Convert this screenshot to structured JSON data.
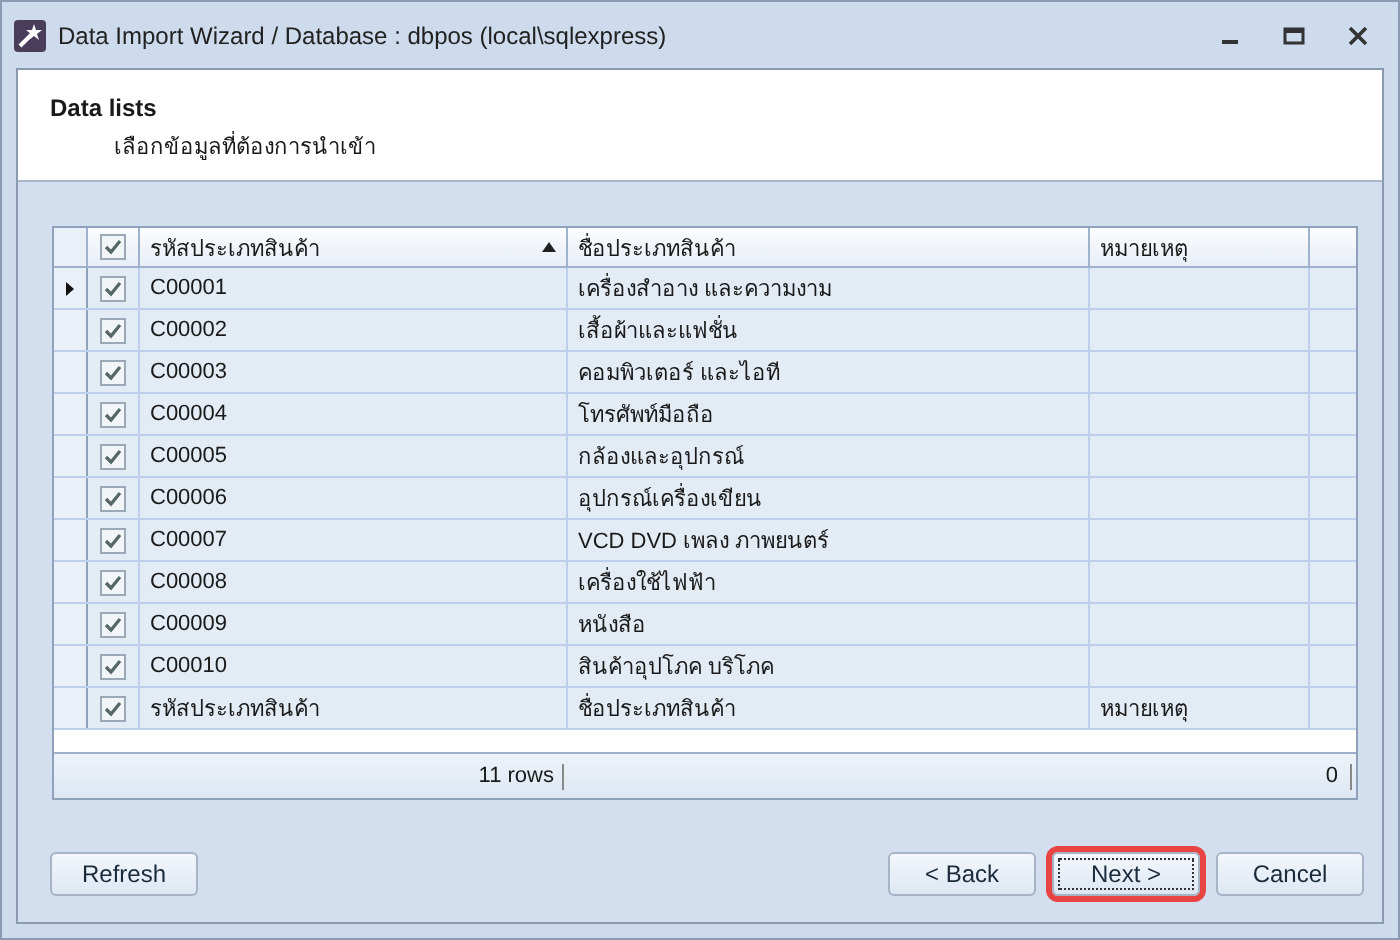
{
  "window": {
    "title": "Data Import Wizard / Database : dbpos (local\\sqlexpress)"
  },
  "header": {
    "title": "Data lists",
    "subtitle": "เลือกข้อมูลที่ต้องการนำเข้า"
  },
  "grid": {
    "all_checked": true,
    "columns": [
      {
        "label": "รหัสประเภทสินค้า",
        "sorted": true
      },
      {
        "label": "ชื่อประเภทสินค้า",
        "sorted": false
      },
      {
        "label": "หมายเหตุ",
        "sorted": false
      }
    ],
    "rows": [
      {
        "current": true,
        "checked": true,
        "code": "C00001",
        "name": "เครื่องสำอาง และความงาม",
        "note": ""
      },
      {
        "current": false,
        "checked": true,
        "code": "C00002",
        "name": "เสื้อผ้าและแฟชั่น",
        "note": ""
      },
      {
        "current": false,
        "checked": true,
        "code": "C00003",
        "name": "คอมพิวเตอร์ และไอที",
        "note": ""
      },
      {
        "current": false,
        "checked": true,
        "code": "C00004",
        "name": "โทรศัพท์มือถือ",
        "note": ""
      },
      {
        "current": false,
        "checked": true,
        "code": "C00005",
        "name": "กล้องและอุปกรณ์",
        "note": ""
      },
      {
        "current": false,
        "checked": true,
        "code": "C00006",
        "name": "อุปกรณ์เครื่องเขียน",
        "note": ""
      },
      {
        "current": false,
        "checked": true,
        "code": "C00007",
        "name": "VCD DVD เพลง ภาพยนตร์",
        "note": ""
      },
      {
        "current": false,
        "checked": true,
        "code": "C00008",
        "name": "เครื่องใช้ไฟฟ้า",
        "note": ""
      },
      {
        "current": false,
        "checked": true,
        "code": "C00009",
        "name": "หนังสือ",
        "note": ""
      },
      {
        "current": false,
        "checked": true,
        "code": "C00010",
        "name": "สินค้าอุปโภค บริโภค",
        "note": ""
      },
      {
        "current": false,
        "checked": true,
        "code": "รหัสประเภทสินค้า",
        "name": "ชื่อประเภทสินค้า",
        "note": "หมายเหตุ"
      }
    ],
    "summary": {
      "count": "11 rows",
      "total": "0"
    }
  },
  "buttons": [
    {
      "label": "Refresh",
      "kind": "left",
      "highlighted": false,
      "focused": false
    },
    {
      "label": "< Back",
      "kind": "right",
      "highlighted": false,
      "focused": false
    },
    {
      "label": "Next >",
      "kind": "right",
      "highlighted": true,
      "focused": true
    },
    {
      "label": "Cancel",
      "kind": "right",
      "highlighted": false,
      "focused": false
    }
  ]
}
